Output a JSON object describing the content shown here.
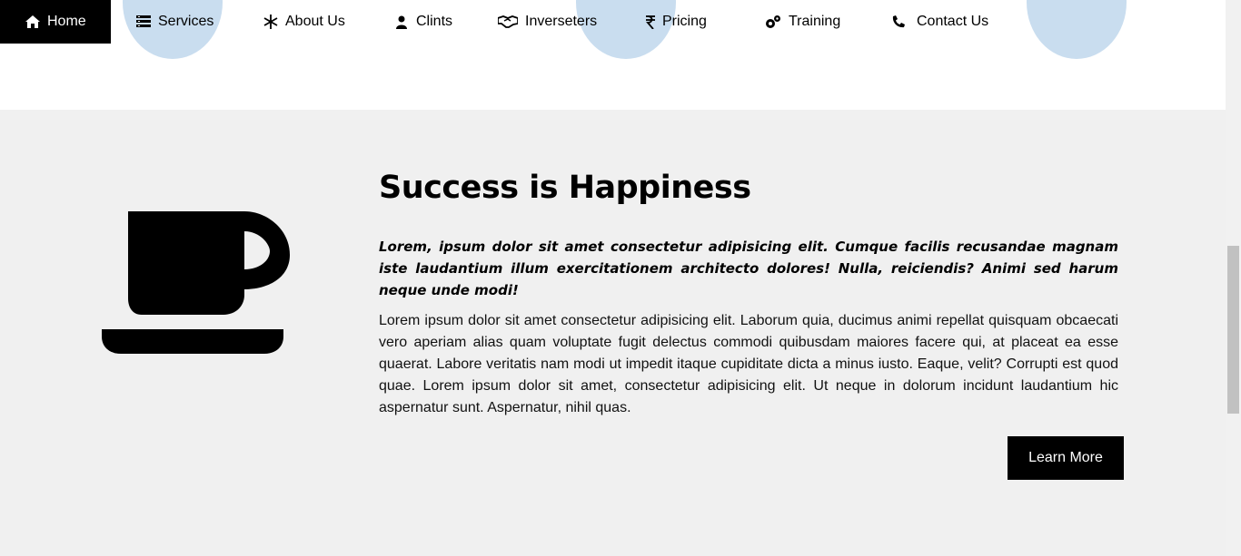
{
  "nav": {
    "items": [
      {
        "label": "Home",
        "icon": "home-icon",
        "active": true
      },
      {
        "label": "Services",
        "icon": "list-icon"
      },
      {
        "label": "About Us",
        "icon": "snowflake-icon"
      },
      {
        "label": "Clints",
        "icon": "user-icon"
      },
      {
        "label": "Inverseters",
        "icon": "handshake-icon"
      },
      {
        "label": "Pricing",
        "icon": "rupee-icon"
      },
      {
        "label": "Training",
        "icon": "gears-icon"
      },
      {
        "label": "Contact Us",
        "icon": "phone-icon"
      }
    ]
  },
  "section": {
    "icon": "coffee-cup-icon",
    "title": "Success is Happiness",
    "lead": "Lorem, ipsum dolor sit amet consectetur adipisicing elit. Cumque facilis recusandae magnam iste laudantium illum exercitationem architecto dolores! Nulla, reiciendis? Animi sed harum neque unde modi!",
    "body": "Lorem ipsum dolor sit amet consectetur adipisicing elit. Laborum quia, ducimus animi repellat quisquam obcaecati vero aperiam alias quam voluptate fugit delectus commodi quibusdam maiores facere qui, at placeat ea esse quaerat. Labore veritatis nam modi ut impedit itaque cupiditate dicta a minus iusto. Eaque, velit? Corrupti est quod quae. Lorem ipsum dolor sit amet, consectetur adipisicing elit. Ut neque in dolorum incidunt laudantium hic aspernatur sunt. Aspernatur, nihil quas.",
    "button": "Learn More"
  },
  "colors": {
    "nav_active_bg": "#000000",
    "section_bg": "#f0f0f0",
    "blob": "#c9ddef",
    "button_bg": "#000000"
  }
}
